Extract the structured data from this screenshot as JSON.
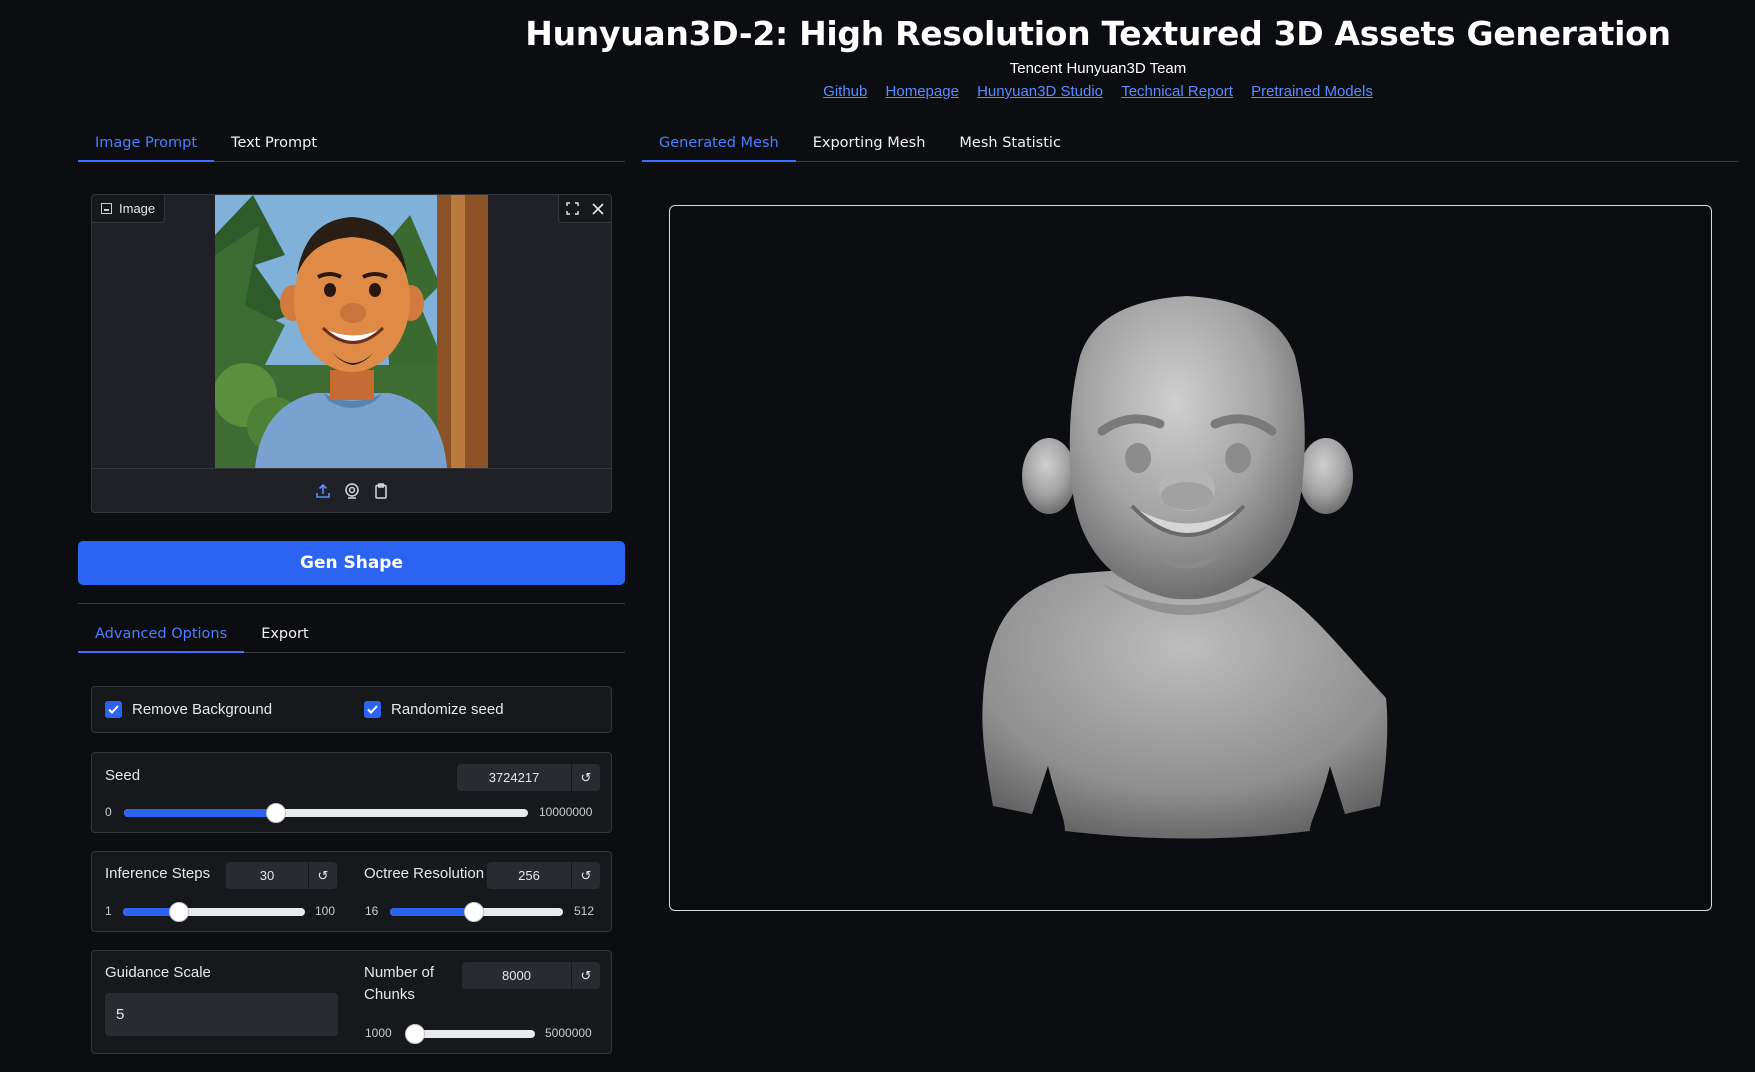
{
  "header": {
    "title": "Hunyuan3D-2: High Resolution Textured 3D Assets Generation",
    "subtitle": "Tencent Hunyuan3D Team",
    "links": [
      "Github",
      "Homepage",
      "Hunyuan3D Studio",
      "Technical Report",
      "Pretrained Models"
    ]
  },
  "colors": {
    "accent": "#2a64f0",
    "tab_active": "#4c7fff",
    "background": "#0c0d10"
  },
  "prompt_tabs": [
    "Image Prompt",
    "Text Prompt"
  ],
  "image_panel": {
    "label": "Image",
    "icons": [
      "image-icon",
      "fullscreen-icon",
      "close-icon",
      "upload-icon",
      "webcam-icon",
      "clipboard-icon"
    ]
  },
  "gen_button": "Gen Shape",
  "option_tabs": [
    "Advanced Options",
    "Export"
  ],
  "options": {
    "remove_background": {
      "label": "Remove Background",
      "checked": true
    },
    "randomize_seed": {
      "label": "Randomize seed",
      "checked": true
    },
    "seed": {
      "label": "Seed",
      "value": "3724217",
      "min": "0",
      "max": "10000000"
    },
    "inference_steps": {
      "label": "Inference Steps",
      "value": "30",
      "min": "1",
      "max": "100"
    },
    "octree_resolution": {
      "label": "Octree Resolution",
      "value": "256",
      "min": "16",
      "max": "512"
    },
    "guidance_scale": {
      "label": "Guidance Scale",
      "value": "5"
    },
    "num_chunks": {
      "label": "Number of Chunks",
      "value": "8000",
      "min": "1000",
      "max": "5000000"
    }
  },
  "mesh_tabs": [
    "Generated Mesh",
    "Exporting Mesh",
    "Mesh Statistic"
  ]
}
